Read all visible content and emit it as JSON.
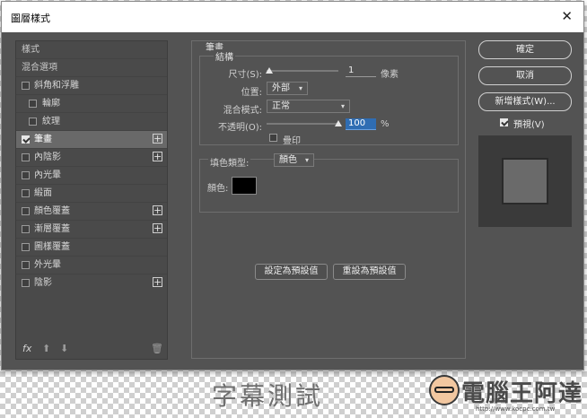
{
  "window": {
    "title": "圖層樣式",
    "close_symbol": "✕"
  },
  "sidebar": {
    "items": [
      {
        "label": "樣式",
        "kind": "header"
      },
      {
        "label": "混合選項",
        "kind": "header"
      },
      {
        "label": "斜角和浮雕",
        "checked": false,
        "plus": false,
        "indent": 0
      },
      {
        "label": "輪廓",
        "checked": false,
        "plus": false,
        "indent": 1
      },
      {
        "label": "紋理",
        "checked": false,
        "plus": false,
        "indent": 1
      },
      {
        "label": "筆畫",
        "checked": true,
        "plus": true,
        "indent": 0,
        "active": true
      },
      {
        "label": "內陰影",
        "checked": false,
        "plus": true,
        "indent": 0
      },
      {
        "label": "內光暈",
        "checked": false,
        "plus": false,
        "indent": 0
      },
      {
        "label": "緞面",
        "checked": false,
        "plus": false,
        "indent": 0
      },
      {
        "label": "顏色覆蓋",
        "checked": false,
        "plus": true,
        "indent": 0
      },
      {
        "label": "漸層覆蓋",
        "checked": false,
        "plus": true,
        "indent": 0
      },
      {
        "label": "圖樣覆蓋",
        "checked": false,
        "plus": false,
        "indent": 0
      },
      {
        "label": "外光暈",
        "checked": false,
        "plus": false,
        "indent": 0
      },
      {
        "label": "陰影",
        "checked": false,
        "plus": true,
        "indent": 0
      }
    ],
    "footer": {
      "fx": "fx",
      "up": "⬆",
      "down": "⬇",
      "trash": "🗑"
    }
  },
  "stroke": {
    "title": "筆畫",
    "structure_title": "結構",
    "size_label": "尺寸(S):",
    "size_value": "1",
    "size_unit": "像素",
    "position_label": "位置:",
    "position_value": "外部",
    "blend_label": "混合模式:",
    "blend_value": "正常",
    "opacity_label": "不透明(O):",
    "opacity_value": "100",
    "opacity_unit": "%",
    "overprint_label": "疊印",
    "fill_type_label": "填色類型:",
    "fill_type_value": "顏色",
    "color_label": "顏色:",
    "color_value": "#000000",
    "set_default": "設定為預設值",
    "reset_default": "重設為預設值"
  },
  "buttons": {
    "ok": "確定",
    "cancel": "取消",
    "new_style": "新增樣式(W)...",
    "preview": "預視(V)"
  },
  "caption": "字幕測試",
  "brand": {
    "name": "電腦王阿達",
    "url": "http://www.kocpc.com.tw"
  }
}
